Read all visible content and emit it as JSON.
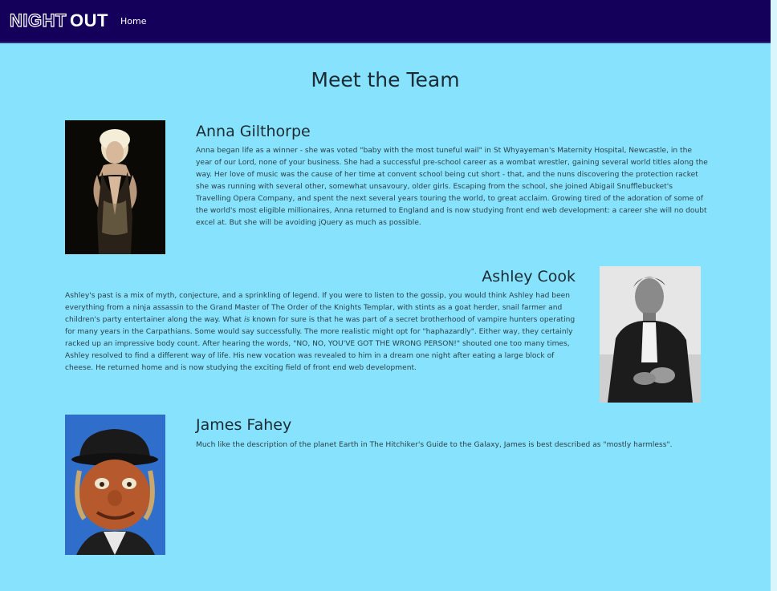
{
  "navbar": {
    "brand_night": "NIGHT",
    "brand_out": "OUT",
    "home_label": "Home"
  },
  "page": {
    "title": "Meet the Team"
  },
  "members": [
    {
      "name": "Anna Gilthorpe",
      "bio_before": "Anna began life as a winner - she was voted \"baby with the most tuneful wail\" in St Whyayeman's Maternity Hospital, Newcastle, in the year of our Lord, none of your business. She had a successful pre-school career as a wombat wrestler, gaining several world titles along the way. Her love of music was the cause of her time at convent school being cut short - that, and the nuns discovering the protection racket she was running with several other, somewhat unsavoury, older girls. Escaping from the school, she joined Abigail Snufflebucket's Travelling Opera Company, and spent the next several years touring the world, to great acclaim. Growing tired of the adoration of some of the world's most eligible millionaires, Anna returned to England and is now studying front end web development: a career she will no doubt excel at. But she will be avoiding jQuery as much as possible."
    },
    {
      "name": "Ashley Cook",
      "bio_before": "Ashley's past is a mix of myth, conjecture, and a sprinkling of legend. If you were to listen to the gossip, you would think Ashley had been everything from a ninja assassin to the Grand Master of The Order of the Knights Templar, with stints as a goat herder, snail farmer and children's party entertainer along the way. What ",
      "bio_emphasis": "is",
      "bio_after": " known for sure is that he was part of a secret brotherhood of vampire hunters operating for many years in the Carpathians. Some would say successfully. The more realistic might opt for \"haphazardly\". Either way, they certainly racked up an impressive body count. After hearing the words, \"NO, NO, YOU'VE GOT THE WRONG PERSON!\" shouted one too many times, Ashley resolved to find a different way of life. His new vocation was revealed to him in a dream one night after eating a large block of cheese. He returned home and is now studying the exciting field of front end web development."
    },
    {
      "name": "James Fahey",
      "bio_before": "Much like the description of the planet Earth in The Hitchiker's Guide to the Galaxy, James is best described as \"mostly harmless\"."
    }
  ],
  "colors": {
    "page_background": "#87e3fd",
    "navbar_background": "#14005a",
    "heading_text": "#1b2a33",
    "body_text": "#2a3e48"
  }
}
